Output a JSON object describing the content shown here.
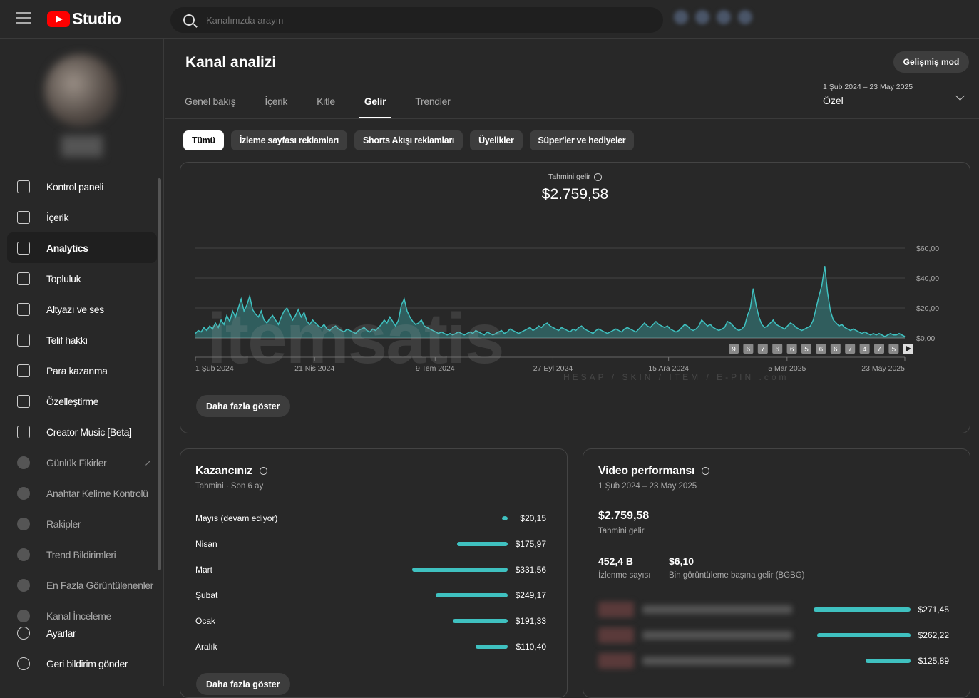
{
  "app": {
    "title": "Studio"
  },
  "search": {
    "placeholder": "Kanalınızda arayın"
  },
  "sidebar": {
    "items": [
      {
        "label": "Kontrol paneli",
        "icon": "dashboard-icon",
        "active": false
      },
      {
        "label": "İçerik",
        "icon": "content-icon",
        "active": false
      },
      {
        "label": "Analytics",
        "icon": "analytics-icon",
        "active": true
      },
      {
        "label": "Topluluk",
        "icon": "community-icon",
        "active": false
      },
      {
        "label": "Altyazı ve ses",
        "icon": "subtitles-icon",
        "active": false
      },
      {
        "label": "Telif hakkı",
        "icon": "copyright-icon",
        "active": false
      },
      {
        "label": "Para kazanma",
        "icon": "dollar-icon",
        "active": false
      },
      {
        "label": "Özelleştirme",
        "icon": "magic-wand-icon",
        "active": false
      },
      {
        "label": "Creator Music [Beta]",
        "icon": "music-icon",
        "active": false
      }
    ],
    "ext_items": [
      {
        "label": "Günlük Fikirler",
        "link": true
      },
      {
        "label": "Anahtar Kelime Kontrolü",
        "link": false
      },
      {
        "label": "Rakipler",
        "link": false
      },
      {
        "label": "Trend Bildirimleri",
        "link": false
      },
      {
        "label": "En Fazla Görüntülenenler",
        "link": false
      },
      {
        "label": "Kanal İnceleme",
        "link": false
      }
    ],
    "bottom": [
      {
        "label": "Ayarlar",
        "icon": "gear-icon"
      },
      {
        "label": "Geri bildirim gönder",
        "icon": "feedback-icon"
      }
    ]
  },
  "main": {
    "title": "Kanal analizi",
    "advanced_mode": "Gelişmiş mod",
    "tabs": [
      "Genel bakış",
      "İçerik",
      "Kitle",
      "Gelir",
      "Trendler"
    ],
    "active_tab": "Gelir",
    "date_range": "1 Şub 2024 – 23 May 2025",
    "date_mode": "Özel",
    "chips": [
      "Tümü",
      "İzleme sayfası reklamları",
      "Shorts Akışı reklamları",
      "Üyelikler",
      "Süper'ler ve hediyeler"
    ],
    "active_chip": "Tümü"
  },
  "revenue": {
    "label": "Tahmini gelir",
    "value": "$2.759,58",
    "show_more": "Daha fazla göster"
  },
  "chart_data": {
    "type": "area",
    "y_ticks": [
      "$60,00",
      "$40,00",
      "$20,00",
      "$0,00"
    ],
    "ylim": [
      0,
      60
    ],
    "x_ticks": [
      "1 Şub 2024",
      "21 Nis 2024",
      "9 Tem 2024",
      "27 Eyl 2024",
      "15 Ara 2024",
      "5 Mar 2025",
      "23 May 2025"
    ],
    "color": "#3fc1c0",
    "markers": [
      "9",
      "6",
      "7",
      "6",
      "6",
      "5",
      "6",
      "6",
      "7",
      "4",
      "7",
      "5"
    ],
    "values": [
      3,
      5,
      4,
      7,
      5,
      8,
      6,
      10,
      7,
      12,
      9,
      15,
      11,
      18,
      14,
      20,
      26,
      18,
      22,
      28,
      19,
      16,
      14,
      18,
      12,
      10,
      13,
      15,
      12,
      9,
      14,
      18,
      20,
      16,
      12,
      15,
      19,
      14,
      17,
      11,
      9,
      12,
      10,
      8,
      7,
      9,
      6,
      5,
      7,
      8,
      6,
      5,
      4,
      6,
      5,
      4,
      3,
      5,
      6,
      7,
      5,
      4,
      6,
      5,
      7,
      9,
      12,
      10,
      14,
      11,
      8,
      12,
      22,
      26,
      18,
      14,
      11,
      9,
      10,
      12,
      8,
      7,
      6,
      5,
      4,
      3,
      4,
      3,
      2,
      3,
      2,
      3,
      4,
      3,
      2,
      3,
      4,
      3,
      5,
      4,
      3,
      2,
      4,
      3,
      2,
      3,
      4,
      5,
      3,
      4,
      6,
      5,
      4,
      3,
      4,
      5,
      6,
      7,
      5,
      6,
      8,
      7,
      9,
      10,
      8,
      7,
      6,
      5,
      7,
      6,
      5,
      4,
      6,
      5,
      7,
      8,
      6,
      5,
      4,
      3,
      5,
      6,
      5,
      4,
      3,
      4,
      5,
      6,
      5,
      4,
      6,
      7,
      6,
      5,
      4,
      6,
      8,
      10,
      8,
      7,
      9,
      11,
      9,
      8,
      7,
      8,
      6,
      5,
      4,
      5,
      7,
      9,
      8,
      6,
      5,
      6,
      8,
      12,
      10,
      8,
      9,
      7,
      6,
      5,
      6,
      7,
      11,
      10,
      8,
      6,
      5,
      6,
      8,
      15,
      20,
      33,
      22,
      14,
      9,
      7,
      8,
      10,
      12,
      9,
      8,
      7,
      6,
      8,
      10,
      9,
      7,
      6,
      5,
      6,
      7,
      8,
      12,
      20,
      28,
      35,
      48,
      30,
      18,
      12,
      10,
      8,
      9,
      7,
      6,
      5,
      6,
      5,
      4,
      3,
      4,
      3,
      2,
      3,
      2,
      3,
      2,
      1,
      2,
      3,
      2,
      2,
      3,
      2,
      1
    ]
  },
  "earnings": {
    "title": "Kazancınız",
    "subtitle": "Tahmini · Son 6 ay",
    "rows": [
      {
        "month": "Mayıs (devam ediyor)",
        "value": "$20,15",
        "amount": 20.15
      },
      {
        "month": "Nisan",
        "value": "$175,97",
        "amount": 175.97
      },
      {
        "month": "Mart",
        "value": "$331,56",
        "amount": 331.56
      },
      {
        "month": "Şubat",
        "value": "$249,17",
        "amount": 249.17
      },
      {
        "month": "Ocak",
        "value": "$191,33",
        "amount": 191.33
      },
      {
        "month": "Aralık",
        "value": "$110,40",
        "amount": 110.4
      }
    ],
    "show_more": "Daha fazla göster"
  },
  "video_perf": {
    "title": "Video performansı",
    "date_range": "1 Şub 2024 – 23 May 2025",
    "revenue_value": "$2.759,58",
    "revenue_label": "Tahmini gelir",
    "views_value": "452,4 B",
    "views_label": "İzlenme sayısı",
    "rpm_value": "$6,10",
    "rpm_label": "Bin görüntüleme başına gelir (BGBG)",
    "videos": [
      {
        "value": "$271,45",
        "amount": 271.45
      },
      {
        "value": "$262,22",
        "amount": 262.22
      },
      {
        "value": "$125,89",
        "amount": 125.89
      }
    ]
  }
}
